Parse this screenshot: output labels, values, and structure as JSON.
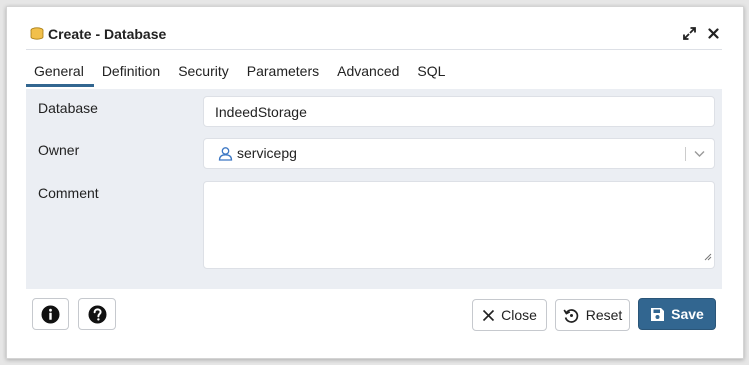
{
  "dialog": {
    "title": "Create - Database",
    "icons": {
      "title": "database-icon",
      "expand": "expand-icon",
      "close": "close-icon"
    }
  },
  "tabs": [
    {
      "label": "General",
      "active": true
    },
    {
      "label": "Definition"
    },
    {
      "label": "Security"
    },
    {
      "label": "Parameters"
    },
    {
      "label": "Advanced"
    },
    {
      "label": "SQL"
    }
  ],
  "form": {
    "database": {
      "label": "Database",
      "value": "IndeedStorage"
    },
    "owner": {
      "label": "Owner",
      "value": "servicepg",
      "icon": "user-icon"
    },
    "comment": {
      "label": "Comment",
      "value": ""
    }
  },
  "footer": {
    "info_icon": "info-icon",
    "help_icon": "help-icon",
    "close_label": "Close",
    "reset_label": "Reset",
    "save_label": "Save"
  },
  "colors": {
    "accent": "#326690",
    "panel": "#ebeef3"
  }
}
